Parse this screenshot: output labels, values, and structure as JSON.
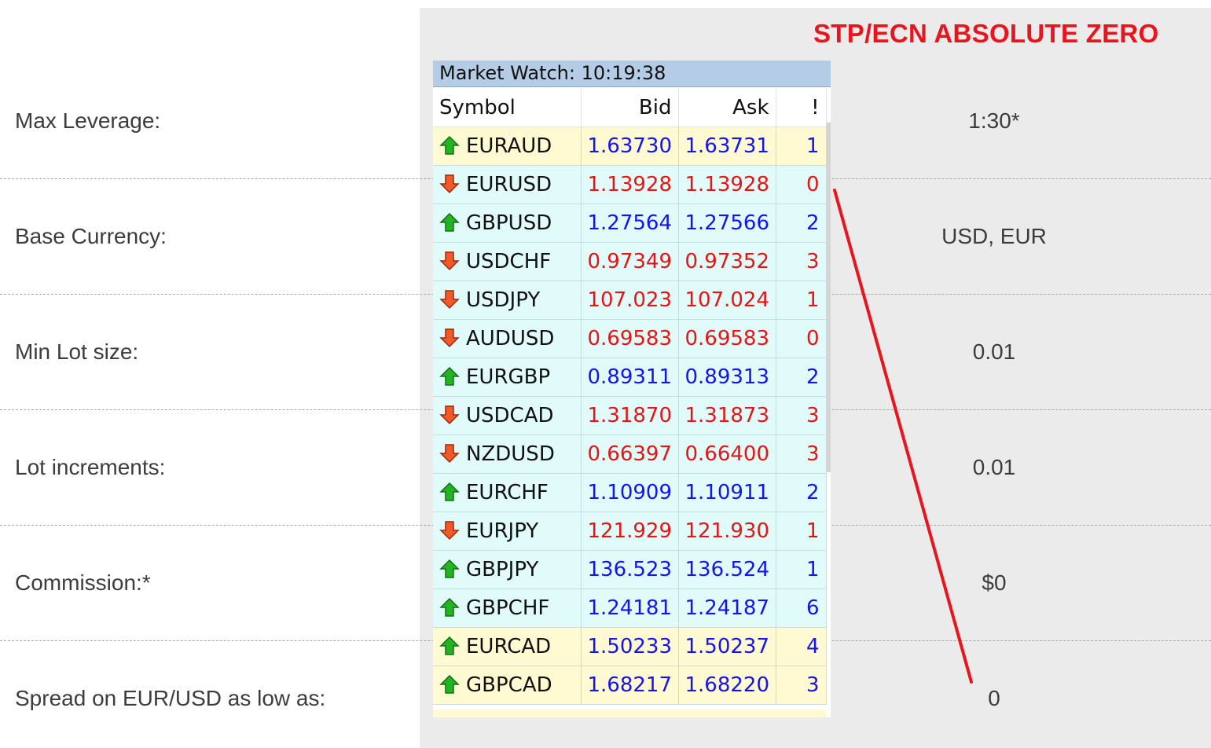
{
  "heading": "STP/ECN ABSOLUTE ZERO",
  "rows": [
    {
      "label": "Max Leverage:",
      "value": "1:30*"
    },
    {
      "label": "Base Currency:",
      "value": "USD, EUR"
    },
    {
      "label": "Min Lot size:",
      "value": "0.01"
    },
    {
      "label": "Lot increments:",
      "value": "0.01"
    },
    {
      "label": "Commission:*",
      "value": "$0"
    },
    {
      "label": "Spread on EUR/USD as low as:",
      "value": "0"
    }
  ],
  "market_watch": {
    "title": "Market Watch: 10:19:38",
    "columns": {
      "symbol": "Symbol",
      "bid": "Bid",
      "ask": "Ask",
      "spread": "!"
    },
    "quotes": [
      {
        "symbol": "EURAUD",
        "bid": "1.63730",
        "ask": "1.63731",
        "spread": "1",
        "direction": "up",
        "bg": "yellow"
      },
      {
        "symbol": "EURUSD",
        "bid": "1.13928",
        "ask": "1.13928",
        "spread": "0",
        "direction": "down",
        "bg": "cyan"
      },
      {
        "symbol": "GBPUSD",
        "bid": "1.27564",
        "ask": "1.27566",
        "spread": "2",
        "direction": "up",
        "bg": "cyan"
      },
      {
        "symbol": "USDCHF",
        "bid": "0.97349",
        "ask": "0.97352",
        "spread": "3",
        "direction": "down",
        "bg": "cyan"
      },
      {
        "symbol": "USDJPY",
        "bid": "107.023",
        "ask": "107.024",
        "spread": "1",
        "direction": "down",
        "bg": "cyan"
      },
      {
        "symbol": "AUDUSD",
        "bid": "0.69583",
        "ask": "0.69583",
        "spread": "0",
        "direction": "down",
        "bg": "cyan"
      },
      {
        "symbol": "EURGBP",
        "bid": "0.89311",
        "ask": "0.89313",
        "spread": "2",
        "direction": "up",
        "bg": "cyan"
      },
      {
        "symbol": "USDCAD",
        "bid": "1.31870",
        "ask": "1.31873",
        "spread": "3",
        "direction": "down",
        "bg": "cyan"
      },
      {
        "symbol": "NZDUSD",
        "bid": "0.66397",
        "ask": "0.66400",
        "spread": "3",
        "direction": "down",
        "bg": "cyan"
      },
      {
        "symbol": "EURCHF",
        "bid": "1.10909",
        "ask": "1.10911",
        "spread": "2",
        "direction": "up",
        "bg": "cyan"
      },
      {
        "symbol": "EURJPY",
        "bid": "121.929",
        "ask": "121.930",
        "spread": "1",
        "direction": "down",
        "bg": "cyan"
      },
      {
        "symbol": "GBPJPY",
        "bid": "136.523",
        "ask": "136.524",
        "spread": "1",
        "direction": "up",
        "bg": "cyan"
      },
      {
        "symbol": "GBPCHF",
        "bid": "1.24181",
        "ask": "1.24187",
        "spread": "6",
        "direction": "up",
        "bg": "cyan"
      },
      {
        "symbol": "EURCAD",
        "bid": "1.50233",
        "ask": "1.50237",
        "spread": "4",
        "direction": "up",
        "bg": "yellow"
      },
      {
        "symbol": "GBPCAD",
        "bid": "1.68217",
        "ask": "1.68220",
        "spread": "3",
        "direction": "up",
        "bg": "yellow"
      }
    ]
  },
  "colors": {
    "heading": "#e8141e",
    "up_price": "#1414f0",
    "down_price": "#e61414",
    "annotation_line": "#e8141e",
    "panel_bg": "#ebebeb"
  },
  "icons": {
    "up": "green-up-arrow-icon",
    "down": "red-down-arrow-icon"
  }
}
